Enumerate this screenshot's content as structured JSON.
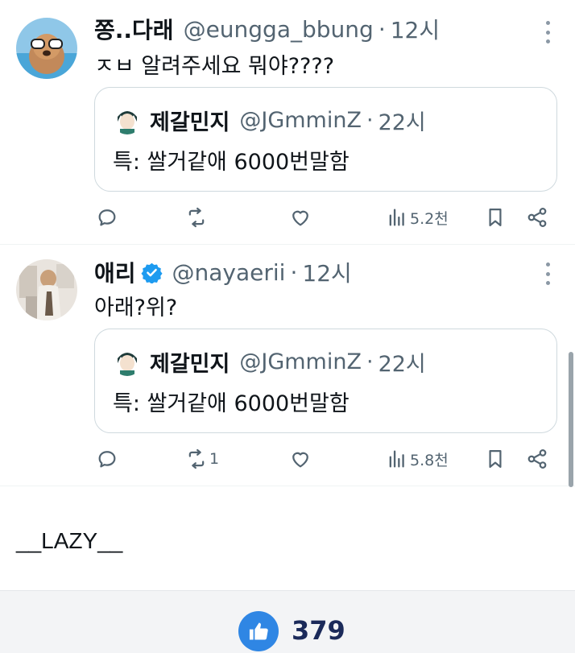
{
  "tweets": [
    {
      "name": "쫑..다래",
      "handle": "@eungga_bbung",
      "separator": "·",
      "time": "12시",
      "verified": false,
      "text": "ㅈㅂ 알려주세요 뭐야????",
      "quote": {
        "name": "제갈민지",
        "handle": "@JGmminZ",
        "separator": "·",
        "time": "22시",
        "text": "특: 쌀거같애 6000번말함"
      },
      "actions": {
        "reply_count": "",
        "retweet_count": "",
        "like_count": "",
        "views": "5.2천"
      }
    },
    {
      "name": "애리",
      "handle": "@nayaerii",
      "separator": "·",
      "time": "12시",
      "verified": true,
      "text": "아래?위?",
      "quote": {
        "name": "제갈민지",
        "handle": "@JGmminZ",
        "separator": "·",
        "time": "22시",
        "text": "특: 쌀거같애 6000번말함"
      },
      "actions": {
        "reply_count": "",
        "retweet_count": "1",
        "like_count": "",
        "views": "5.8천"
      }
    }
  ],
  "caption": "__LAZY__",
  "footer": {
    "like_total": "379",
    "like_color": "#2f86e4"
  },
  "colors": {
    "text": "#0f1419",
    "muted": "#536471",
    "verified": "#1d9bf0",
    "border": "#cfd9de"
  }
}
